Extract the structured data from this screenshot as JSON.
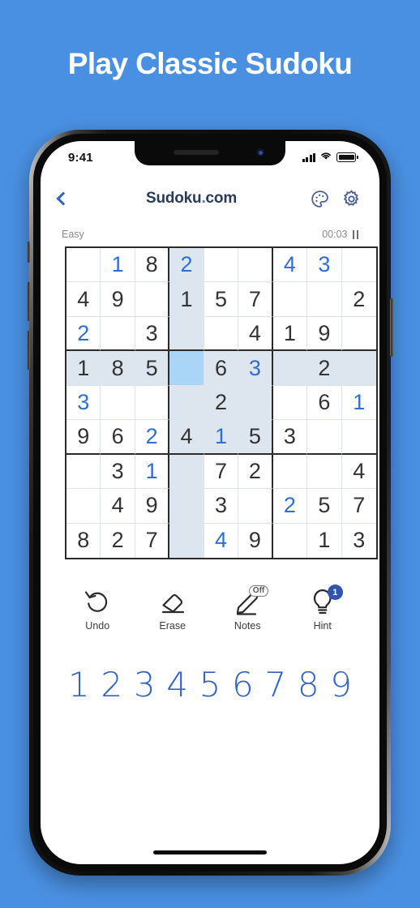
{
  "banner": {
    "headline": "Play Classic Sudoku"
  },
  "status_bar": {
    "time": "9:41",
    "signal_icon": "cellular-signal-icon",
    "wifi_icon": "wifi-icon",
    "battery_icon": "battery-full-icon"
  },
  "app_bar": {
    "back_icon": "back-chevron-icon",
    "title_main": "Sudoku",
    "title_dot": ".",
    "title_tld": "com",
    "palette_icon": "palette-icon",
    "settings_icon": "gear-icon"
  },
  "meta": {
    "difficulty": "Easy",
    "timer": "00:03",
    "pause_icon": "pause-icon"
  },
  "board": {
    "selected": {
      "row": 3,
      "col": 3
    },
    "colors": {
      "given": "#333333",
      "user": "#2f6fd0",
      "highlight": "#dde5ef",
      "selected": "#a9d6f7",
      "grid_line": "#2b2b2b"
    },
    "rows": [
      [
        {
          "v": "",
          "t": "given"
        },
        {
          "v": "1",
          "t": "user"
        },
        {
          "v": "8",
          "t": "given"
        },
        {
          "v": "2",
          "t": "user"
        },
        {
          "v": "",
          "t": "given"
        },
        {
          "v": "",
          "t": "given"
        },
        {
          "v": "4",
          "t": "user"
        },
        {
          "v": "3",
          "t": "user"
        },
        {
          "v": "",
          "t": "given"
        }
      ],
      [
        {
          "v": "4",
          "t": "given"
        },
        {
          "v": "9",
          "t": "given"
        },
        {
          "v": "",
          "t": "given"
        },
        {
          "v": "1",
          "t": "given"
        },
        {
          "v": "5",
          "t": "given"
        },
        {
          "v": "7",
          "t": "given"
        },
        {
          "v": "",
          "t": "given"
        },
        {
          "v": "",
          "t": "given"
        },
        {
          "v": "2",
          "t": "given"
        }
      ],
      [
        {
          "v": "2",
          "t": "user"
        },
        {
          "v": "",
          "t": "given"
        },
        {
          "v": "3",
          "t": "given"
        },
        {
          "v": "",
          "t": "given"
        },
        {
          "v": "",
          "t": "given"
        },
        {
          "v": "4",
          "t": "given"
        },
        {
          "v": "1",
          "t": "given"
        },
        {
          "v": "9",
          "t": "given"
        },
        {
          "v": "",
          "t": "given"
        }
      ],
      [
        {
          "v": "1",
          "t": "given"
        },
        {
          "v": "8",
          "t": "given"
        },
        {
          "v": "5",
          "t": "given"
        },
        {
          "v": "",
          "t": "given"
        },
        {
          "v": "6",
          "t": "given"
        },
        {
          "v": "3",
          "t": "user"
        },
        {
          "v": "",
          "t": "given"
        },
        {
          "v": "2",
          "t": "given"
        },
        {
          "v": "",
          "t": "given"
        }
      ],
      [
        {
          "v": "3",
          "t": "user"
        },
        {
          "v": "",
          "t": "given"
        },
        {
          "v": "",
          "t": "given"
        },
        {
          "v": "",
          "t": "given"
        },
        {
          "v": "2",
          "t": "given"
        },
        {
          "v": "",
          "t": "given"
        },
        {
          "v": "",
          "t": "given"
        },
        {
          "v": "6",
          "t": "given"
        },
        {
          "v": "1",
          "t": "user"
        }
      ],
      [
        {
          "v": "9",
          "t": "given"
        },
        {
          "v": "6",
          "t": "given"
        },
        {
          "v": "2",
          "t": "user"
        },
        {
          "v": "4",
          "t": "given"
        },
        {
          "v": "1",
          "t": "user"
        },
        {
          "v": "5",
          "t": "given"
        },
        {
          "v": "3",
          "t": "given"
        },
        {
          "v": "",
          "t": "given"
        },
        {
          "v": "",
          "t": "given"
        }
      ],
      [
        {
          "v": "",
          "t": "given"
        },
        {
          "v": "3",
          "t": "given"
        },
        {
          "v": "1",
          "t": "user"
        },
        {
          "v": "",
          "t": "given"
        },
        {
          "v": "7",
          "t": "given"
        },
        {
          "v": "2",
          "t": "given"
        },
        {
          "v": "",
          "t": "given"
        },
        {
          "v": "",
          "t": "given"
        },
        {
          "v": "4",
          "t": "given"
        }
      ],
      [
        {
          "v": "",
          "t": "given"
        },
        {
          "v": "4",
          "t": "given"
        },
        {
          "v": "9",
          "t": "given"
        },
        {
          "v": "",
          "t": "given"
        },
        {
          "v": "3",
          "t": "given"
        },
        {
          "v": "",
          "t": "given"
        },
        {
          "v": "2",
          "t": "user"
        },
        {
          "v": "5",
          "t": "given"
        },
        {
          "v": "7",
          "t": "given"
        }
      ],
      [
        {
          "v": "8",
          "t": "given"
        },
        {
          "v": "2",
          "t": "given"
        },
        {
          "v": "7",
          "t": "given"
        },
        {
          "v": "",
          "t": "given"
        },
        {
          "v": "4",
          "t": "user"
        },
        {
          "v": "9",
          "t": "given"
        },
        {
          "v": "",
          "t": "given"
        },
        {
          "v": "1",
          "t": "given"
        },
        {
          "v": "3",
          "t": "given"
        }
      ]
    ]
  },
  "tools": [
    {
      "label": "Undo",
      "icon": "undo-icon",
      "badge": null,
      "badge_type": null
    },
    {
      "label": "Erase",
      "icon": "eraser-icon",
      "badge": null,
      "badge_type": null
    },
    {
      "label": "Notes",
      "icon": "pencil-icon",
      "badge": "Off",
      "badge_type": "text"
    },
    {
      "label": "Hint",
      "icon": "lightbulb-icon",
      "badge": "1",
      "badge_type": "count"
    }
  ],
  "numpad": [
    "1",
    "2",
    "3",
    "4",
    "5",
    "6",
    "7",
    "8",
    "9"
  ],
  "home_indicator": "home-indicator"
}
